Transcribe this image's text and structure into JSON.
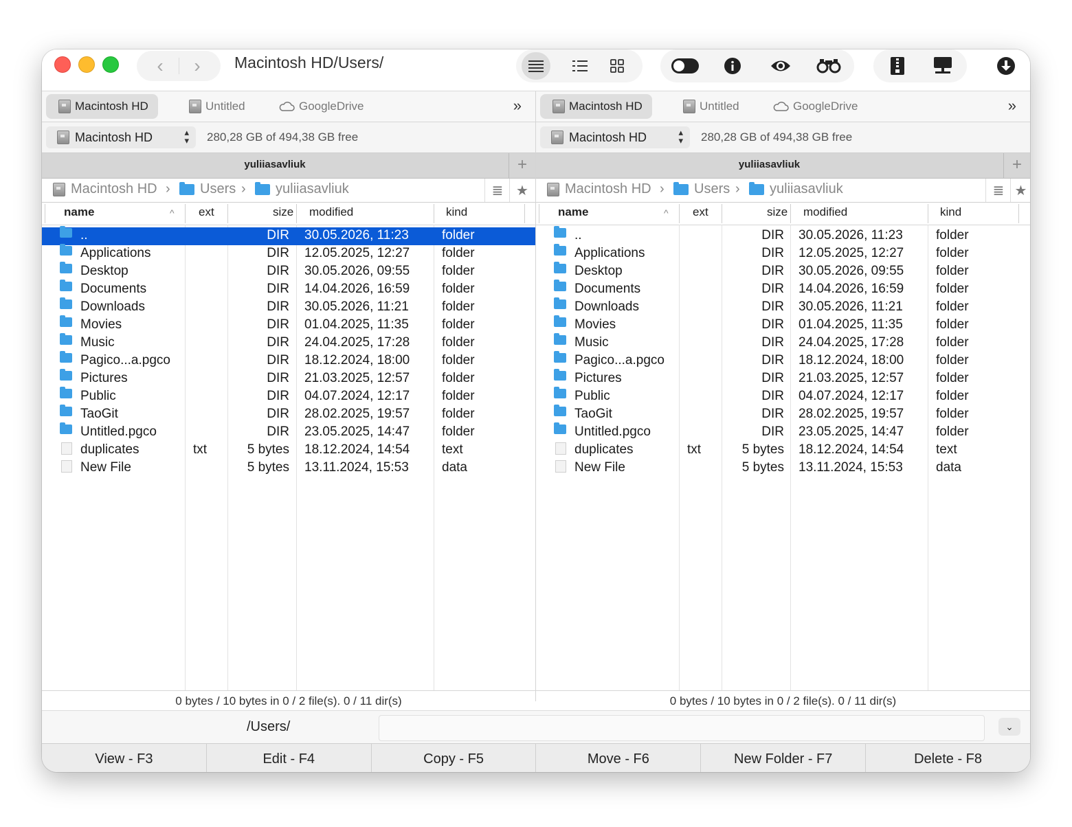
{
  "window": {
    "title": "Macintosh HD/Users/"
  },
  "toolbar": {
    "back_glyph": "‹",
    "forward_glyph": "›",
    "icons": [
      "list-view-icon",
      "detail-view-icon",
      "grid-view-icon",
      "toggle-hidden-icon",
      "info-icon",
      "quick-look-icon",
      "find-binoculars-icon",
      "archive-icon",
      "network-icon",
      "download-icon"
    ]
  },
  "tabs": [
    {
      "label": "Macintosh HD",
      "active": true
    },
    {
      "label": "Untitled",
      "active": false
    },
    {
      "label": "GoogleDrive",
      "active": false
    }
  ],
  "tabs_overflow": "»",
  "volume": {
    "selected": "Macintosh HD",
    "free_text": "280,28 GB of 494,38 GB free"
  },
  "panel_title": "yuliiasavliuk",
  "plus_label": "+",
  "breadcrumb": [
    "Macintosh HD",
    "Users",
    "yuliiasavliuk"
  ],
  "breadcrumb_separator": "›",
  "columns": {
    "name": "name",
    "ext": "ext",
    "size": "size",
    "modified": "modified",
    "kind": "kind"
  },
  "sort_indicator": "^",
  "files": [
    {
      "name": "..",
      "ext": "",
      "size": "DIR",
      "modified": "30.05.2026, 11:23",
      "kind": "folder",
      "type": "folder"
    },
    {
      "name": "Applications",
      "ext": "",
      "size": "DIR",
      "modified": "12.05.2025, 12:27",
      "kind": "folder",
      "type": "folder"
    },
    {
      "name": "Desktop",
      "ext": "",
      "size": "DIR",
      "modified": "30.05.2026, 09:55",
      "kind": "folder",
      "type": "folder"
    },
    {
      "name": "Documents",
      "ext": "",
      "size": "DIR",
      "modified": "14.04.2026, 16:59",
      "kind": "folder",
      "type": "folder"
    },
    {
      "name": "Downloads",
      "ext": "",
      "size": "DIR",
      "modified": "30.05.2026, 11:21",
      "kind": "folder",
      "type": "folder"
    },
    {
      "name": "Movies",
      "ext": "",
      "size": "DIR",
      "modified": "01.04.2025, 11:35",
      "kind": "folder",
      "type": "folder"
    },
    {
      "name": "Music",
      "ext": "",
      "size": "DIR",
      "modified": "24.04.2025, 17:28",
      "kind": "folder",
      "type": "folder"
    },
    {
      "name": "Pagico...a.pgco",
      "ext": "",
      "size": "DIR",
      "modified": "18.12.2024, 18:00",
      "kind": "folder",
      "type": "folder"
    },
    {
      "name": "Pictures",
      "ext": "",
      "size": "DIR",
      "modified": "21.03.2025, 12:57",
      "kind": "folder",
      "type": "folder"
    },
    {
      "name": "Public",
      "ext": "",
      "size": "DIR",
      "modified": "04.07.2024, 12:17",
      "kind": "folder",
      "type": "folder"
    },
    {
      "name": "TaoGit",
      "ext": "",
      "size": "DIR",
      "modified": "28.02.2025, 19:57",
      "kind": "folder",
      "type": "folder"
    },
    {
      "name": "Untitled.pgco",
      "ext": "",
      "size": "DIR",
      "modified": "23.05.2025, 14:47",
      "kind": "folder",
      "type": "folder"
    },
    {
      "name": "duplicates",
      "ext": "txt",
      "size": "5 bytes",
      "modified": "18.12.2024, 14:54",
      "kind": "text",
      "type": "file"
    },
    {
      "name": "New File",
      "ext": "",
      "size": "5 bytes",
      "modified": "13.11.2024, 15:53",
      "kind": "data",
      "type": "file"
    }
  ],
  "left_selected_index": 0,
  "status_text": "0 bytes / 10 bytes in 0 / 2 file(s). 0 / 11 dir(s)",
  "command": {
    "path": "/Users/",
    "dropdown_glyph": "⌄"
  },
  "fkeys": [
    "View - F3",
    "Edit - F4",
    "Copy - F5",
    "Move - F6",
    "New Folder - F7",
    "Delete - F8"
  ],
  "colors": {
    "selection": "#0b5bd7",
    "folder": "#3da0e6",
    "close": "#fe5f57",
    "minimize": "#febc2e",
    "zoom": "#28c840"
  }
}
